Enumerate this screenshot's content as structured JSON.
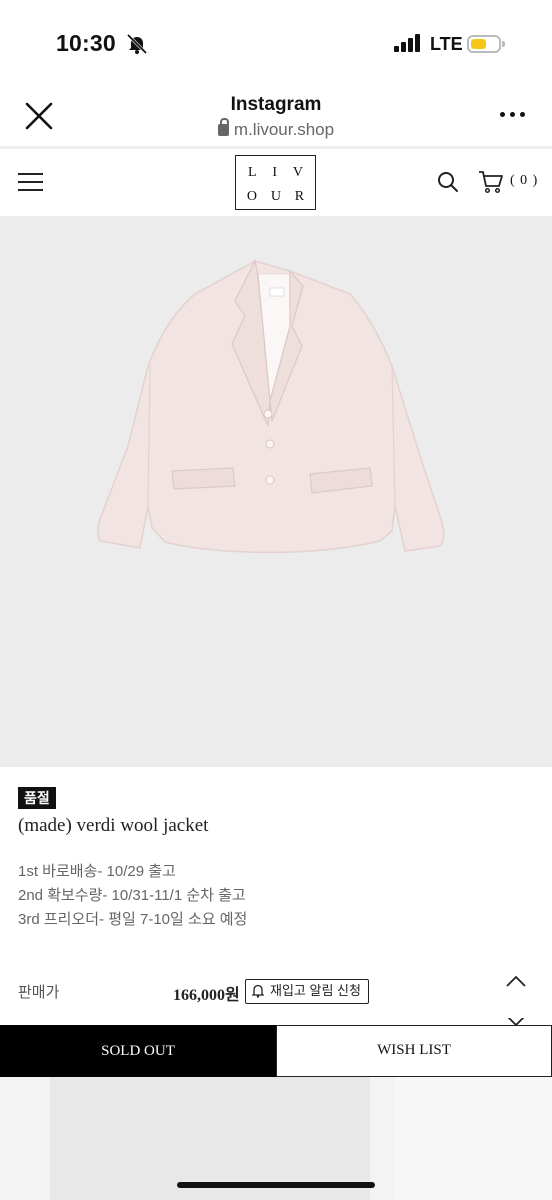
{
  "status_bar": {
    "time": "10:30",
    "network": "LTE",
    "battery_color": "#f5c518"
  },
  "browser": {
    "title": "Instagram",
    "url": "m.livour.shop",
    "close_icon": "close-icon",
    "more_icon": "more-icon"
  },
  "site": {
    "logo_row1": [
      "L",
      "I",
      "V"
    ],
    "logo_row2": [
      "O",
      "U",
      "R"
    ],
    "cart_count": "( 0 )"
  },
  "product": {
    "badge": "품절",
    "name": "(made) verdi wool jacket",
    "shipping": [
      "1st 바로배송- 10/29 출고",
      "2nd 확보수량- 10/31-11/1 순차 출고",
      "3rd 프리오더- 평일 7-10일 소요 예정"
    ],
    "price_label": "판매가",
    "price": "166,000원",
    "restock_label": "재입고 알림 신청",
    "jacket_color": "#f1e4e2"
  },
  "actions": {
    "soldout_label": "SOLD OUT",
    "wishlist_label": "WISH LIST"
  }
}
